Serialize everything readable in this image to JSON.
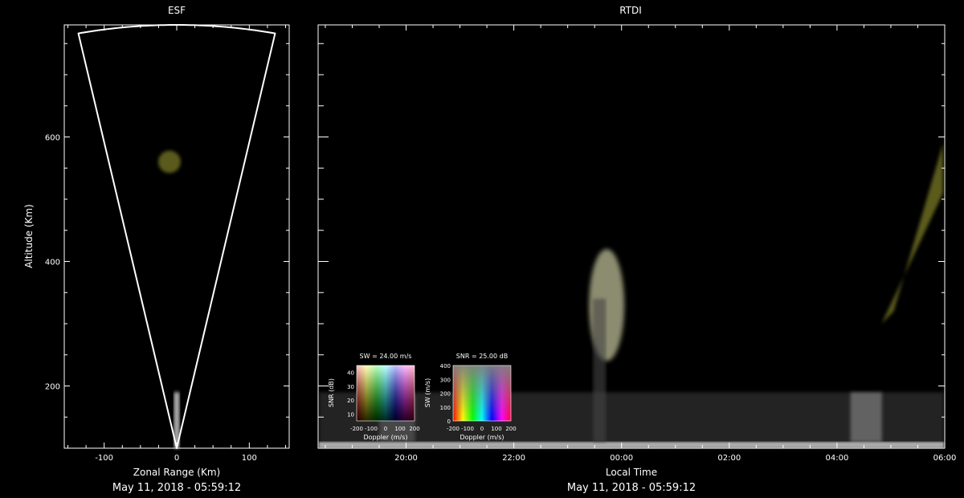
{
  "chart_data": [
    {
      "type": "heatmap",
      "title": "ESF",
      "xlabel": "Zonal Range (Km)",
      "ylabel": "Altitude (Km)",
      "caption": "May 11, 2018 - 05:59:12",
      "xlim": [
        -155,
        155
      ],
      "ylim": [
        100,
        780
      ],
      "xticks": [
        -100,
        0,
        100
      ],
      "yticks": [
        200,
        400,
        600
      ],
      "scan_fan": {
        "half_angle_deg": 11.5,
        "origin": [
          0,
          100
        ],
        "max_range_km": 680
      },
      "echoes": [
        {
          "zonal_km": -10,
          "altitude_km": 560,
          "snr_db": 9,
          "doppler_ms": 20,
          "color": "#6b6a22"
        },
        {
          "zonal_km": 0,
          "altitude_km": 150,
          "snr_db": 30,
          "doppler_ms": 0,
          "color": "#dcdcdc"
        }
      ]
    },
    {
      "type": "heatmap",
      "title": "RTDI",
      "xlabel": "Local Time",
      "caption": "May 11, 2018 - 05:59:12",
      "xlim": [
        "18:22",
        "06:00"
      ],
      "ylim": [
        100,
        780
      ],
      "xticks": [
        "20:00",
        "22:00",
        "00:00",
        "02:00",
        "04:00",
        "06:00"
      ],
      "yticks": [
        200,
        400,
        600
      ],
      "plumes": [
        {
          "time": "23:30",
          "alt_min": 240,
          "alt_max": 420,
          "color": "#c8c8a0"
        },
        {
          "time": "05:30",
          "alt_min": 300,
          "alt_max": 590,
          "color": "#7a7a28"
        }
      ],
      "bottomside_layer": {
        "alt_min": 100,
        "alt_max": 190,
        "color": "#a0a0a0"
      }
    }
  ],
  "legends": {
    "doppler_snr": {
      "title": "SW = 24.00 m/s",
      "xlabel": "Doppler (m/s)",
      "ylabel": "SNR (dB)",
      "xticks": [
        "-200",
        "-100",
        "0",
        "100",
        "200"
      ],
      "yticks": [
        "10",
        "20",
        "30",
        "40"
      ]
    },
    "doppler_sw": {
      "title": "SNR = 25.00 dB",
      "xlabel": "Doppler (m/s)",
      "ylabel": "SW (m/s)",
      "xticks": [
        "-200",
        "-100",
        "0",
        "100",
        "200"
      ],
      "yticks": [
        "0",
        "100",
        "200",
        "300",
        "400"
      ]
    }
  }
}
